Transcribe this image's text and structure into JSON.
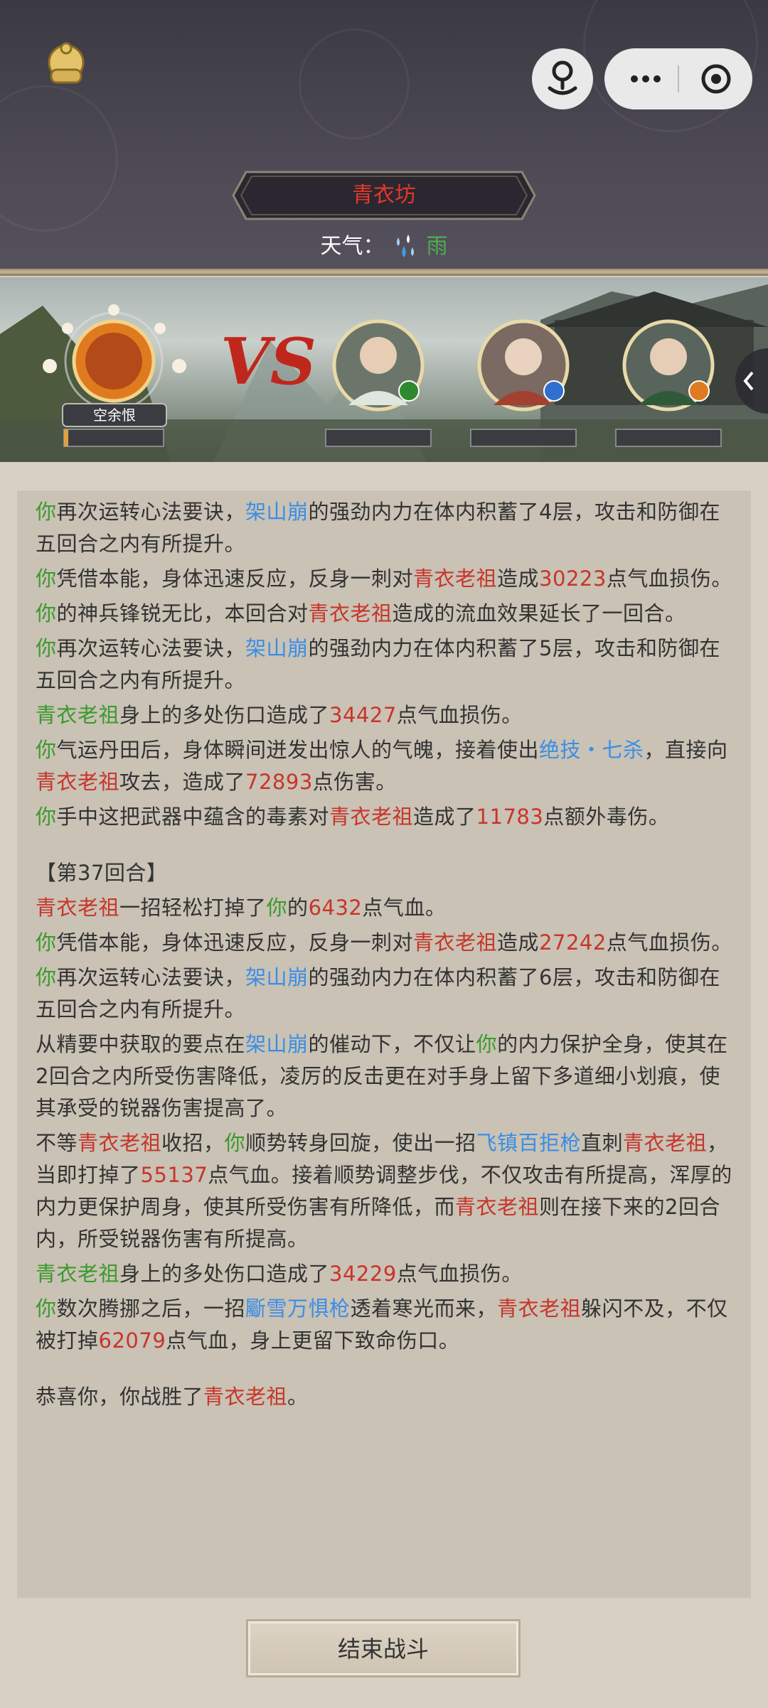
{
  "header": {
    "title": "青衣坊",
    "weather_label": "天气：",
    "weather_value": "雨"
  },
  "player": {
    "name": "空余恨"
  },
  "log": [
    [
      {
        "c": "g",
        "t": "你"
      },
      {
        "c": "n",
        "t": "再次运转心法要诀，"
      },
      {
        "c": "b",
        "t": "架山崩"
      },
      {
        "c": "n",
        "t": "的强劲内力在体内积蓄了4层，攻击和防御在五回合之内有所提升。"
      }
    ],
    [
      {
        "c": "g",
        "t": "你"
      },
      {
        "c": "n",
        "t": "凭借本能，身体迅速反应，反身一刺对"
      },
      {
        "c": "r",
        "t": "青衣老祖"
      },
      {
        "c": "n",
        "t": "造成"
      },
      {
        "c": "r",
        "t": "30223"
      },
      {
        "c": "n",
        "t": "点气血损伤。"
      }
    ],
    [
      {
        "c": "g",
        "t": "你"
      },
      {
        "c": "n",
        "t": "的神兵锋锐无比，本回合对"
      },
      {
        "c": "r",
        "t": "青衣老祖"
      },
      {
        "c": "n",
        "t": "造成的流血效果延长了一回合。"
      }
    ],
    [
      {
        "c": "g",
        "t": "你"
      },
      {
        "c": "n",
        "t": "再次运转心法要诀，"
      },
      {
        "c": "b",
        "t": "架山崩"
      },
      {
        "c": "n",
        "t": "的强劲内力在体内积蓄了5层，攻击和防御在五回合之内有所提升。"
      }
    ],
    [
      {
        "c": "g",
        "t": "青衣老祖"
      },
      {
        "c": "n",
        "t": "身上的多处伤口造成了"
      },
      {
        "c": "r",
        "t": "34427"
      },
      {
        "c": "n",
        "t": "点气血损伤。"
      }
    ],
    [
      {
        "c": "g",
        "t": "你"
      },
      {
        "c": "n",
        "t": "气运丹田后，身体瞬间迸发出惊人的气魄，接着使出"
      },
      {
        "c": "b",
        "t": "绝技・七杀"
      },
      {
        "c": "n",
        "t": "，直接向"
      },
      {
        "c": "r",
        "t": "青衣老祖"
      },
      {
        "c": "n",
        "t": "攻去，造成了"
      },
      {
        "c": "r",
        "t": "72893"
      },
      {
        "c": "n",
        "t": "点伤害。"
      }
    ],
    [
      {
        "c": "g",
        "t": "你"
      },
      {
        "c": "n",
        "t": "手中这把武器中蕴含的毒素对"
      },
      {
        "c": "r",
        "t": "青衣老祖"
      },
      {
        "c": "n",
        "t": "造成了"
      },
      {
        "c": "r",
        "t": "11783"
      },
      {
        "c": "n",
        "t": "点额外毒伤。"
      }
    ],
    "gap",
    [
      {
        "c": "n",
        "t": "【第37回合】"
      }
    ],
    [
      {
        "c": "r",
        "t": "青衣老祖"
      },
      {
        "c": "n",
        "t": "一招轻松打掉了"
      },
      {
        "c": "g",
        "t": "你"
      },
      {
        "c": "n",
        "t": "的"
      },
      {
        "c": "r",
        "t": "6432"
      },
      {
        "c": "n",
        "t": "点气血。"
      }
    ],
    [
      {
        "c": "g",
        "t": "你"
      },
      {
        "c": "n",
        "t": "凭借本能，身体迅速反应，反身一刺对"
      },
      {
        "c": "r",
        "t": "青衣老祖"
      },
      {
        "c": "n",
        "t": "造成"
      },
      {
        "c": "r",
        "t": "27242"
      },
      {
        "c": "n",
        "t": "点气血损伤。"
      }
    ],
    [
      {
        "c": "g",
        "t": "你"
      },
      {
        "c": "n",
        "t": "再次运转心法要诀，"
      },
      {
        "c": "b",
        "t": "架山崩"
      },
      {
        "c": "n",
        "t": "的强劲内力在体内积蓄了6层，攻击和防御在五回合之内有所提升。"
      }
    ],
    [
      {
        "c": "n",
        "t": "从精要中获取的要点在"
      },
      {
        "c": "b",
        "t": "架山崩"
      },
      {
        "c": "n",
        "t": "的催动下，不仅让"
      },
      {
        "c": "g",
        "t": "你"
      },
      {
        "c": "n",
        "t": "的内力保护全身，使其在2回合之内所受伤害降低，凌厉的反击更在对手身上留下多道细小划痕，使其承受的锐器伤害提高了。"
      }
    ],
    [
      {
        "c": "n",
        "t": "不等"
      },
      {
        "c": "r",
        "t": "青衣老祖"
      },
      {
        "c": "n",
        "t": "收招，"
      },
      {
        "c": "g",
        "t": "你"
      },
      {
        "c": "n",
        "t": "顺势转身回旋，使出一招"
      },
      {
        "c": "b",
        "t": "飞镇百拒枪"
      },
      {
        "c": "n",
        "t": "直刺"
      },
      {
        "c": "r",
        "t": "青衣老祖"
      },
      {
        "c": "n",
        "t": "，当即打掉了"
      },
      {
        "c": "r",
        "t": "55137"
      },
      {
        "c": "n",
        "t": "点气血。接着顺势调整步伐，不仅攻击有所提高，浑厚的内力更保护周身，使其所受伤害有所降低，而"
      },
      {
        "c": "r",
        "t": "青衣老祖"
      },
      {
        "c": "n",
        "t": "则在接下来的2回合内，所受锐器伤害有所提高。"
      }
    ],
    [
      {
        "c": "g",
        "t": "青衣老祖"
      },
      {
        "c": "n",
        "t": "身上的多处伤口造成了"
      },
      {
        "c": "r",
        "t": "34229"
      },
      {
        "c": "n",
        "t": "点气血损伤。"
      }
    ],
    [
      {
        "c": "g",
        "t": "你"
      },
      {
        "c": "n",
        "t": "数次腾挪之后，一招"
      },
      {
        "c": "b",
        "t": "斸雪万惧枪"
      },
      {
        "c": "n",
        "t": "透着寒光而来，"
      },
      {
        "c": "r",
        "t": "青衣老祖"
      },
      {
        "c": "n",
        "t": "躲闪不及，不仅被打掉"
      },
      {
        "c": "r",
        "t": "62079"
      },
      {
        "c": "n",
        "t": "点气血，身上更留下致命伤口。"
      }
    ],
    "gap",
    [
      {
        "c": "n",
        "t": "恭喜你，你战胜了"
      },
      {
        "c": "r",
        "t": "青衣老祖"
      },
      {
        "c": "n",
        "t": "。"
      }
    ]
  ],
  "end_button": "结束战斗"
}
